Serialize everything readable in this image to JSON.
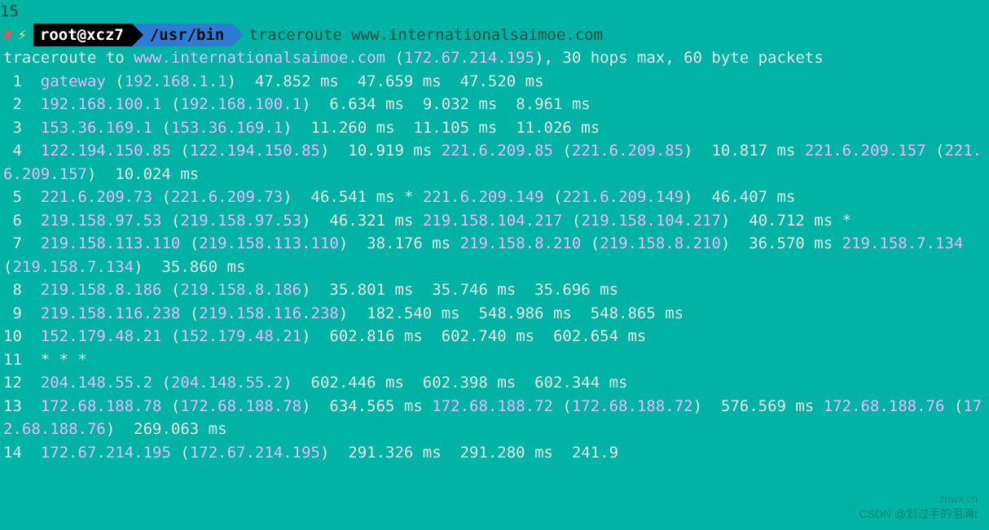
{
  "prompt": {
    "top_fragment": "15",
    "x": "✘",
    "bolt": "⚡",
    "user": "root@xcz7",
    "path": "/usr/bin",
    "command": "traceroute www.internationalsaimoe.com"
  },
  "header": {
    "prefix": "traceroute to ",
    "host": "www.internationalsaimoe.com",
    "mid": " (",
    "ip": "172.67.214.195",
    "suffix": "), 30 hops max, 60 byte packets"
  },
  "hops": [
    {
      "n": " 1",
      "segs": [
        {
          "t": "host",
          "v": "gateway"
        },
        {
          "t": "plain",
          "v": " ("
        },
        {
          "t": "ip",
          "v": "192.168.1.1"
        },
        {
          "t": "plain",
          "v": ")  47.852 ms  47.659 ms  47.520 ms"
        }
      ]
    },
    {
      "n": " 2",
      "segs": [
        {
          "t": "host",
          "v": "192.168.100.1"
        },
        {
          "t": "plain",
          "v": " ("
        },
        {
          "t": "ip",
          "v": "192.168.100.1"
        },
        {
          "t": "plain",
          "v": ")  6.634 ms  9.032 ms  8.961 ms"
        }
      ]
    },
    {
      "n": " 3",
      "segs": [
        {
          "t": "host",
          "v": "153.36.169.1"
        },
        {
          "t": "plain",
          "v": " ("
        },
        {
          "t": "ip",
          "v": "153.36.169.1"
        },
        {
          "t": "plain",
          "v": ")  11.260 ms  11.105 ms  11.026 ms"
        }
      ]
    },
    {
      "n": " 4",
      "segs": [
        {
          "t": "host",
          "v": "122.194.150.85"
        },
        {
          "t": "plain",
          "v": " ("
        },
        {
          "t": "ip",
          "v": "122.194.150.85"
        },
        {
          "t": "plain",
          "v": ")  10.919 ms "
        },
        {
          "t": "host",
          "v": "221.6.209.85"
        },
        {
          "t": "plain",
          "v": " ("
        },
        {
          "t": "ip",
          "v": "221.6.209.85"
        },
        {
          "t": "plain",
          "v": ")  10.817 ms "
        },
        {
          "t": "host",
          "v": "221.6.209.157"
        },
        {
          "t": "plain",
          "v": " ("
        },
        {
          "t": "ip",
          "v": "221.6.209.157"
        },
        {
          "t": "plain",
          "v": ")  10.024 ms"
        }
      ]
    },
    {
      "n": " 5",
      "segs": [
        {
          "t": "host",
          "v": "221.6.209.73"
        },
        {
          "t": "plain",
          "v": " ("
        },
        {
          "t": "ip",
          "v": "221.6.209.73"
        },
        {
          "t": "plain",
          "v": ")  46.541 ms * "
        },
        {
          "t": "host",
          "v": "221.6.209.149"
        },
        {
          "t": "plain",
          "v": " ("
        },
        {
          "t": "ip",
          "v": "221.6.209.149"
        },
        {
          "t": "plain",
          "v": ")  46.407 ms"
        }
      ]
    },
    {
      "n": " 6",
      "segs": [
        {
          "t": "host",
          "v": "219.158.97.53"
        },
        {
          "t": "plain",
          "v": " ("
        },
        {
          "t": "ip",
          "v": "219.158.97.53"
        },
        {
          "t": "plain",
          "v": ")  46.321 ms "
        },
        {
          "t": "host",
          "v": "219.158.104.217"
        },
        {
          "t": "plain",
          "v": " ("
        },
        {
          "t": "ip",
          "v": "219.158.104.217"
        },
        {
          "t": "plain",
          "v": ")  40.712 ms *"
        }
      ]
    },
    {
      "n": " 7",
      "segs": [
        {
          "t": "host",
          "v": "219.158.113.110"
        },
        {
          "t": "plain",
          "v": " ("
        },
        {
          "t": "ip",
          "v": "219.158.113.110"
        },
        {
          "t": "plain",
          "v": ")  38.176 ms "
        },
        {
          "t": "host",
          "v": "219.158.8.210"
        },
        {
          "t": "plain",
          "v": " ("
        },
        {
          "t": "ip",
          "v": "219.158.8.210"
        },
        {
          "t": "plain",
          "v": ")  36.570 ms "
        },
        {
          "t": "host",
          "v": "219.158.7.134"
        },
        {
          "t": "plain",
          "v": " ("
        },
        {
          "t": "ip",
          "v": "219.158.7.134"
        },
        {
          "t": "plain",
          "v": ")  35.860 ms"
        }
      ]
    },
    {
      "n": " 8",
      "segs": [
        {
          "t": "host",
          "v": "219.158.8.186"
        },
        {
          "t": "plain",
          "v": " ("
        },
        {
          "t": "ip",
          "v": "219.158.8.186"
        },
        {
          "t": "plain",
          "v": ")  35.801 ms  35.746 ms  35.696 ms"
        }
      ]
    },
    {
      "n": " 9",
      "segs": [
        {
          "t": "host",
          "v": "219.158.116.238"
        },
        {
          "t": "plain",
          "v": " ("
        },
        {
          "t": "ip",
          "v": "219.158.116.238"
        },
        {
          "t": "plain",
          "v": ")  182.540 ms  548.986 ms  548.865 ms"
        }
      ]
    },
    {
      "n": "10",
      "segs": [
        {
          "t": "host",
          "v": "152.179.48.21"
        },
        {
          "t": "plain",
          "v": " ("
        },
        {
          "t": "ip",
          "v": "152.179.48.21"
        },
        {
          "t": "plain",
          "v": ")  602.816 ms  602.740 ms  602.654 ms"
        }
      ]
    },
    {
      "n": "11",
      "segs": [
        {
          "t": "plain",
          "v": "* * *"
        }
      ]
    },
    {
      "n": "12",
      "segs": [
        {
          "t": "host",
          "v": "204.148.55.2"
        },
        {
          "t": "plain",
          "v": " ("
        },
        {
          "t": "ip",
          "v": "204.148.55.2"
        },
        {
          "t": "plain",
          "v": ")  602.446 ms  602.398 ms  602.344 ms"
        }
      ]
    },
    {
      "n": "13",
      "segs": [
        {
          "t": "host",
          "v": "172.68.188.78"
        },
        {
          "t": "plain",
          "v": " ("
        },
        {
          "t": "ip",
          "v": "172.68.188.78"
        },
        {
          "t": "plain",
          "v": ")  634.565 ms "
        },
        {
          "t": "host",
          "v": "172.68.188.72"
        },
        {
          "t": "plain",
          "v": " ("
        },
        {
          "t": "ip",
          "v": "172.68.188.72"
        },
        {
          "t": "plain",
          "v": ")  576.569 ms "
        },
        {
          "t": "host",
          "v": "172.68.188.76"
        },
        {
          "t": "plain",
          "v": " ("
        },
        {
          "t": "ip",
          "v": "172.68.188.76"
        },
        {
          "t": "plain",
          "v": ")  269.063 ms"
        }
      ]
    },
    {
      "n": "14",
      "segs": [
        {
          "t": "host",
          "v": "172.67.214.195"
        },
        {
          "t": "plain",
          "v": " ("
        },
        {
          "t": "ip",
          "v": "172.67.214.195"
        },
        {
          "t": "plain",
          "v": ")  291.326 ms  291.280 ms  241.9"
        }
      ]
    }
  ],
  "watermark": "CSDN @划过手的泪滴t",
  "watermark2": "znwx.cn"
}
